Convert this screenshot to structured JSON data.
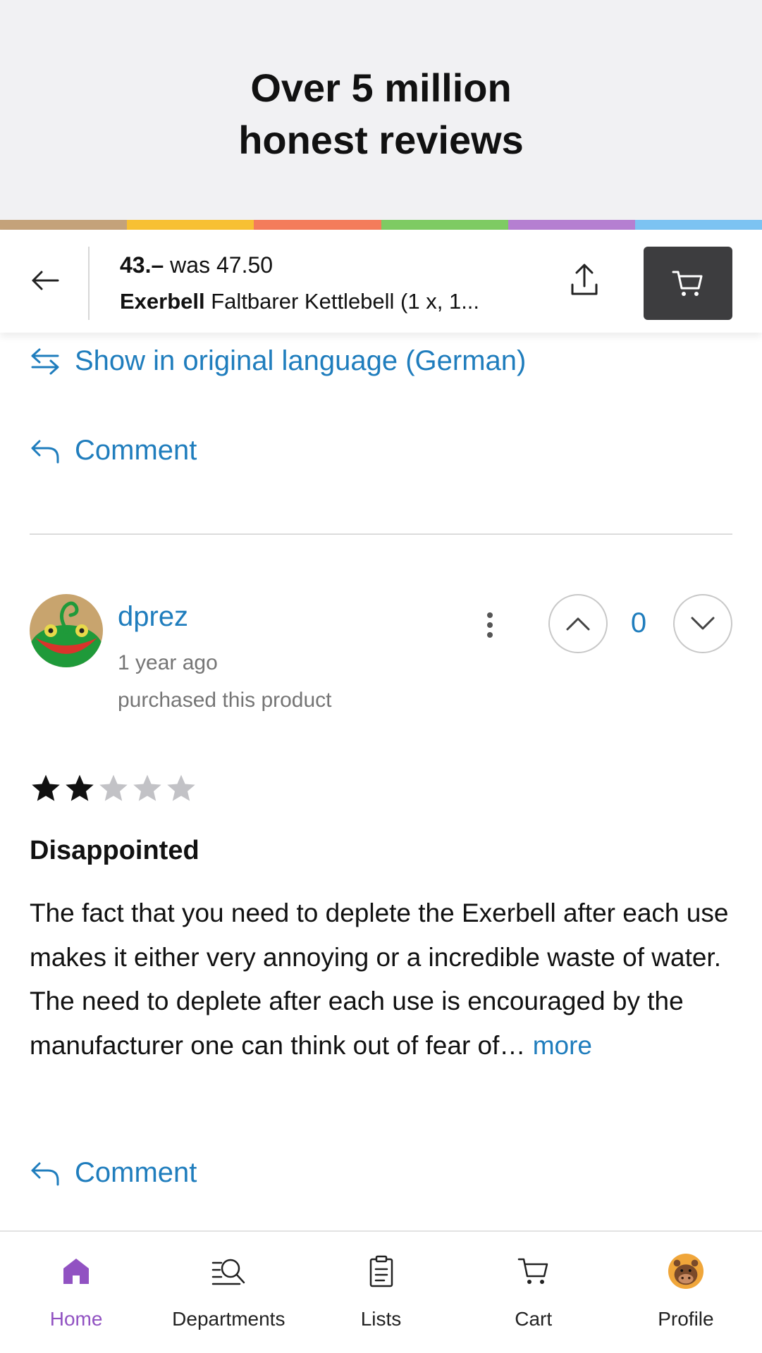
{
  "banner": {
    "title_line1": "Over 5 million",
    "title_line2": "honest reviews",
    "stripe_colors": [
      "#c4a27a",
      "#f7c033",
      "#f47c5b",
      "#7ecb63",
      "#b57fd1",
      "#7cc3f2"
    ]
  },
  "product_bar": {
    "price": "43.–",
    "was_label": "was 47.50",
    "brand": "Exerbell",
    "name": "Faltbarer Kettlebell (1 x, 1...",
    "back_icon": "arrow-left-icon",
    "share_icon": "share-upload-icon",
    "cart_icon": "cart-icon"
  },
  "previous_review": {
    "translate_label": "Show in original language (German)",
    "comment_label": "Comment"
  },
  "review": {
    "username": "dprez",
    "time_ago": "1 year ago",
    "purchased_note": "purchased this product",
    "vote_count": "0",
    "rating": 2,
    "max_rating": 5,
    "title": "Disappointed",
    "body": "The fact that you need to deplete the Exerbell after each use makes it either very annoying or a incredible waste of water. The need to deplete after each use is encouraged by the manufacturer one can think out of fear of…",
    "more_label": "more",
    "comment_label": "Comment"
  },
  "bottom_nav": {
    "items": [
      {
        "label": "Home",
        "icon": "home-icon",
        "active": true
      },
      {
        "label": "Departments",
        "icon": "departments-search-icon",
        "active": false
      },
      {
        "label": "Lists",
        "icon": "list-clipboard-icon",
        "active": false
      },
      {
        "label": "Cart",
        "icon": "cart-icon",
        "active": false
      },
      {
        "label": "Profile",
        "icon": "profile-avatar-icon",
        "active": false
      }
    ]
  },
  "colors": {
    "link_blue": "#1f7dbd",
    "active_purple": "#9152c2",
    "star_filled": "#111111",
    "star_empty": "#c2c2c6",
    "cart_button_bg": "#3d3d3f"
  }
}
